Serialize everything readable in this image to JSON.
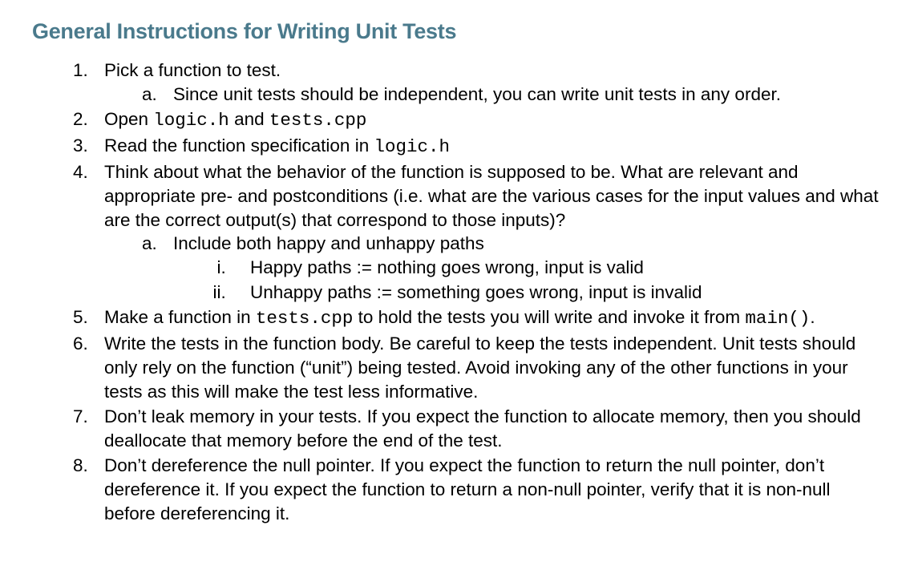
{
  "heading": "General Instructions for Writing Unit Tests",
  "items": {
    "i1": "Pick a function to test.",
    "i1a": "Since unit tests should be independent, you can write unit tests in any order.",
    "i2_pre": "Open ",
    "i2_code1": "logic.h",
    "i2_mid": " and ",
    "i2_code2": "tests.cpp",
    "i3_pre": "Read the function specification in ",
    "i3_code": "logic.h",
    "i4": "Think about what the behavior of the function is supposed to be.  What are relevant and appropriate pre- and postconditions (i.e. what are the various cases for the input values and what are the correct output(s) that correspond to those inputs)?",
    "i4a": "Include both happy and unhappy paths",
    "i4ai": "Happy paths := nothing goes wrong, input is valid",
    "i4aii": "Unhappy paths := something goes wrong, input is invalid",
    "i5_pre": "Make a function in ",
    "i5_code1": "tests.cpp",
    "i5_mid": " to hold the tests you will write and invoke it from ",
    "i5_code2": "main()",
    "i5_end": ".",
    "i6": "Write the tests in the function body.  Be careful to keep the tests independent.  Unit tests should only rely on the function (“unit”) being tested.  Avoid invoking any of the other functions in your tests as this will make the test less informative.",
    "i7": "Don’t leak memory in your tests.  If you expect the function to allocate memory, then you should deallocate that memory before the end of the test.",
    "i8": "Don’t dereference the null pointer.  If you expect the function to return the null pointer, don’t dereference it.  If you expect the function to return a non-null pointer, verify that it is non-null before dereferencing it."
  }
}
